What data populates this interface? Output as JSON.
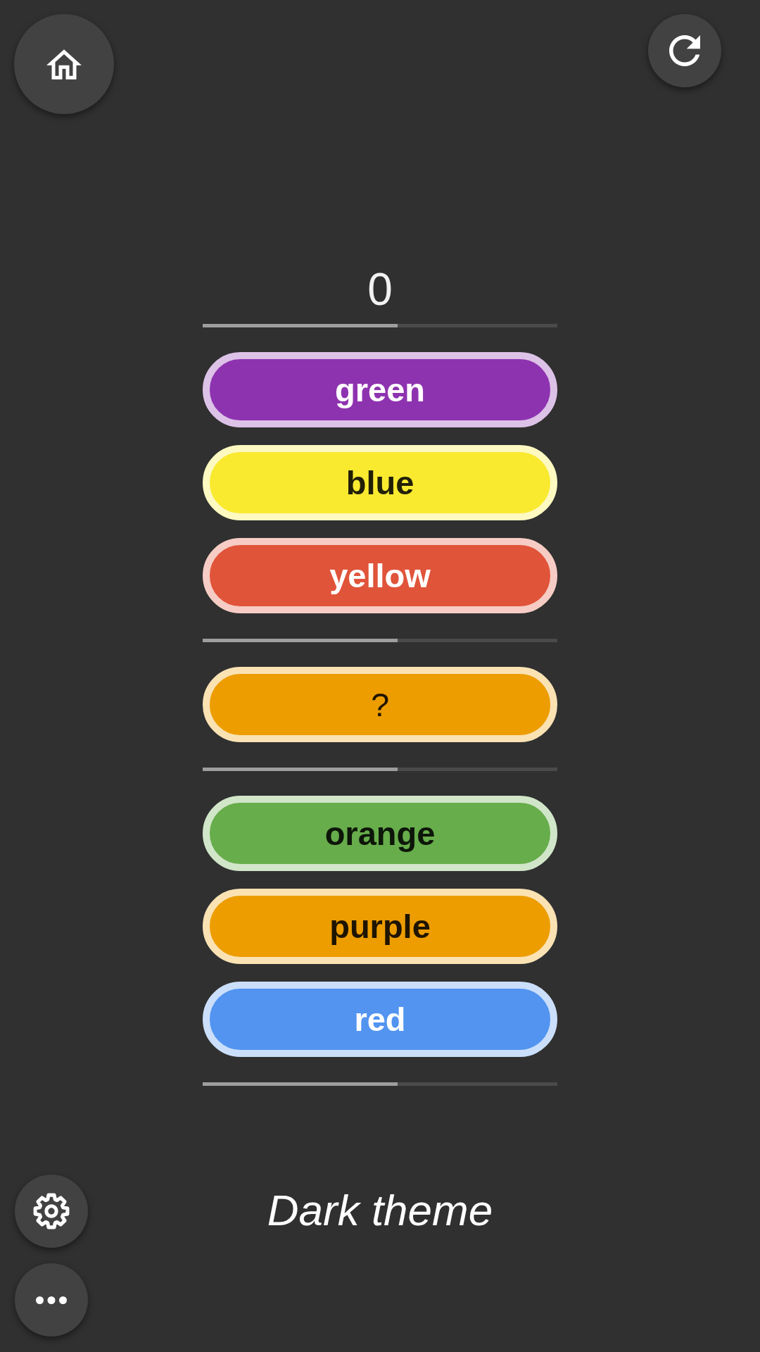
{
  "score": "0",
  "rows": [
    {
      "kind": "bar",
      "level": 0.55
    },
    {
      "kind": "word",
      "label": "green",
      "color": "#8e33b0",
      "light_text": true
    },
    {
      "kind": "word",
      "label": "blue",
      "color": "#f9ea30",
      "light_text": false
    },
    {
      "kind": "word",
      "label": "yellow",
      "color": "#e0543a",
      "light_text": true
    },
    {
      "kind": "bar",
      "level": 0.55
    },
    {
      "kind": "prompt",
      "label": "?",
      "color": "#ed9d00",
      "light_text": false
    },
    {
      "kind": "bar",
      "level": 0.55
    },
    {
      "kind": "word",
      "label": "orange",
      "color": "#67ad4b",
      "light_text": false
    },
    {
      "kind": "word",
      "label": "purple",
      "color": "#ed9d00",
      "light_text": false
    },
    {
      "kind": "word",
      "label": "red",
      "color": "#5294f0",
      "light_text": true
    },
    {
      "kind": "bar",
      "level": 0.55
    }
  ],
  "theme_label": "Dark theme"
}
